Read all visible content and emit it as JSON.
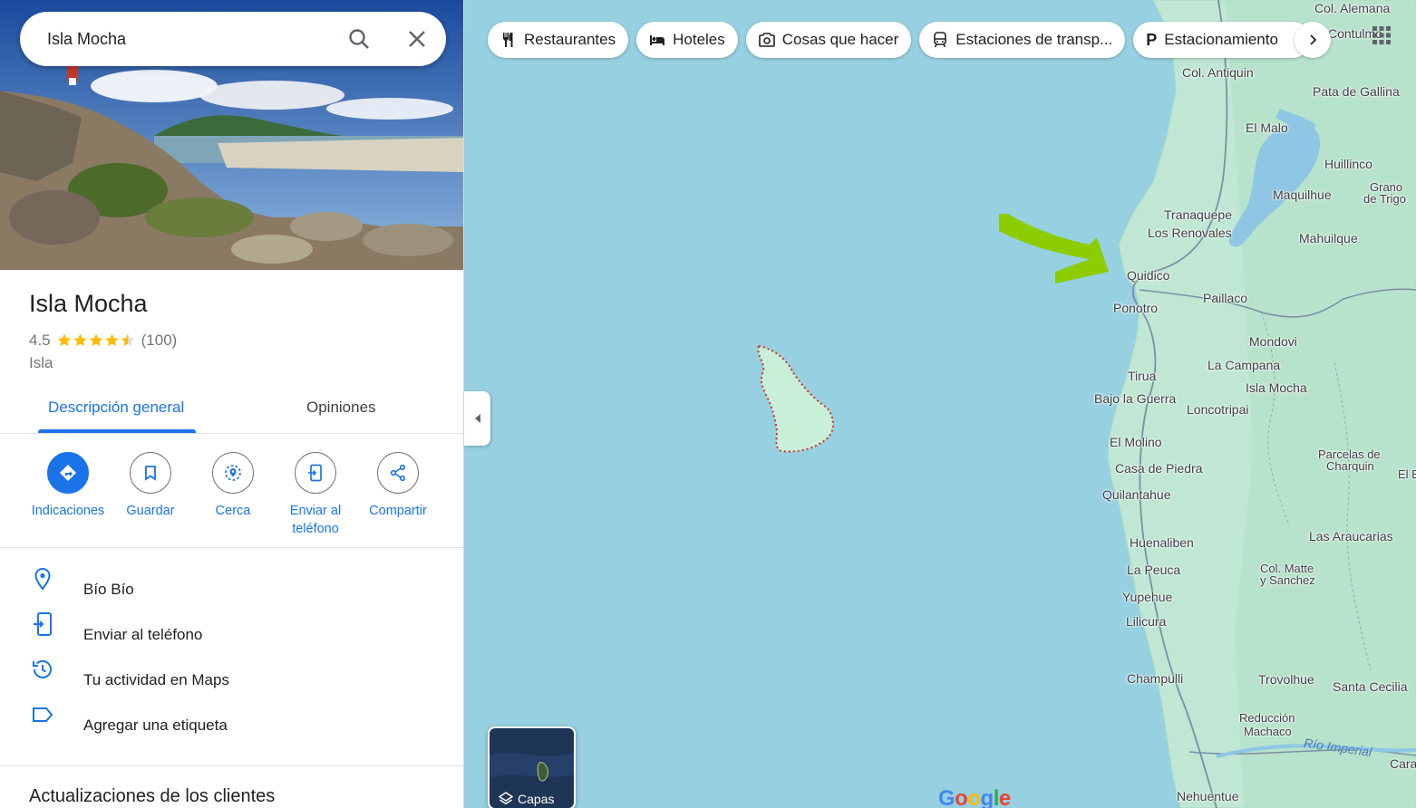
{
  "search": {
    "value": "Isla Mocha"
  },
  "place": {
    "title": "Isla Mocha",
    "rating": "4.5",
    "reviews_count": "(100)",
    "stars": 4.5,
    "type": "Isla"
  },
  "tabs": [
    {
      "label": "Descripción general",
      "active": true
    },
    {
      "label": "Opiniones",
      "active": false
    }
  ],
  "actions": [
    {
      "label": "Indicaciones",
      "icon": "directions-icon"
    },
    {
      "label": "Guardar",
      "icon": "bookmark-icon"
    },
    {
      "label": "Cerca",
      "icon": "nearby-icon"
    },
    {
      "label": "Enviar al teléfono",
      "icon": "send-to-phone-icon"
    },
    {
      "label": "Compartir",
      "icon": "share-icon"
    }
  ],
  "info_rows": [
    {
      "text": "Bío Bío",
      "icon": "location-pin-icon"
    },
    {
      "text": "Enviar al teléfono",
      "icon": "phone-icon"
    },
    {
      "text": "Tu actividad en Maps",
      "icon": "history-icon"
    },
    {
      "text": "Agregar una etiqueta",
      "icon": "label-icon"
    }
  ],
  "updates_title": "Actualizaciones de los clientes",
  "chips": [
    {
      "label": "Restaurantes",
      "icon": "restaurant-icon"
    },
    {
      "label": "Hoteles",
      "icon": "hotel-icon"
    },
    {
      "label": "Cosas que hacer",
      "icon": "camera-icon"
    },
    {
      "label": "Estaciones de transp...",
      "icon": "transit-icon"
    },
    {
      "label": "Estacionamiento",
      "icon": "parking-icon"
    }
  ],
  "layers_label": "Capas",
  "map": {
    "island_label": "Isla Mocha",
    "places": [
      "Col. Alemana",
      "Contulmo",
      "Col. Antiquin",
      "Pata de Gallina",
      "El Malo",
      "Huillinco",
      "Maquilhue",
      "Grano",
      "de Trigo",
      "Tranaquepe",
      "Los Renovales",
      "Mahuilque",
      "Quidico",
      "Paillaco",
      "Ponotro",
      "Mondovi",
      "La Campana",
      "Tirua",
      "Bajo la Guerra",
      "Loncotripai",
      "El Molino",
      "Parcelas de",
      "Charquin",
      "El E",
      "Casa de Piedra",
      "Quilantahue",
      "Las Araucarias",
      "Huenaliben",
      "La Peuca",
      "Col. Matte",
      "y Sanchez",
      "Yupehue",
      "Lilicura",
      "Champulli",
      "Trovolhue",
      "Santa Cecilia",
      "Reducción",
      "Machaco",
      "Río Imperial",
      "Cara",
      "Nehuentue"
    ]
  },
  "google_logo": "Google",
  "colors": {
    "accent": "#1a73e8",
    "water": "#96d0e1",
    "land": "#bfe7d3",
    "arrow": "#8ccc00"
  }
}
